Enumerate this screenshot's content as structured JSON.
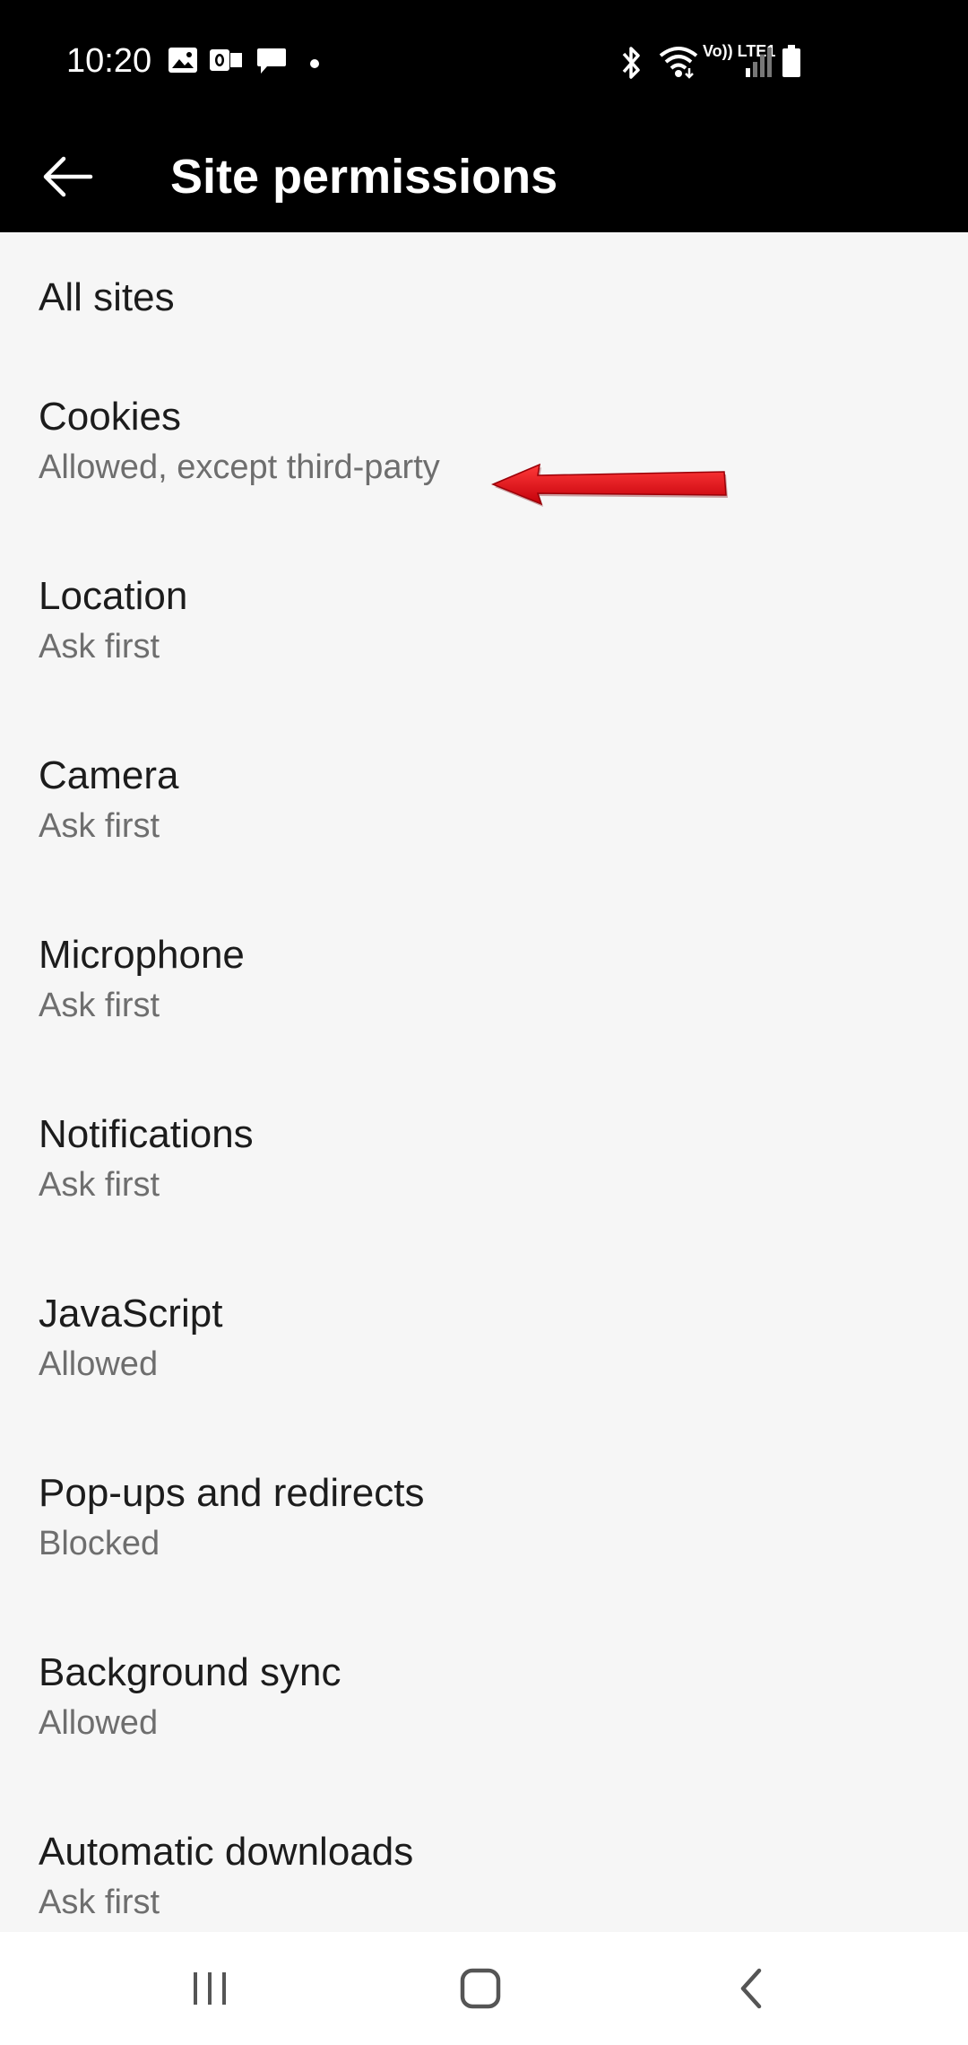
{
  "status_bar": {
    "time": "10:20",
    "icons_left": [
      "gallery-icon",
      "outlook-icon",
      "message-icon",
      "dot-icon"
    ],
    "icons_right": [
      "bluetooth-icon",
      "wifi-icon",
      "volte-icon",
      "signal-icon",
      "battery-icon"
    ],
    "volte_label": "Vo)) LTE1"
  },
  "app_bar": {
    "title": "Site permissions",
    "back_icon": "arrow-left-icon"
  },
  "permissions": [
    {
      "title": "All sites",
      "subtitle": ""
    },
    {
      "title": "Cookies",
      "subtitle": "Allowed, except third-party"
    },
    {
      "title": "Location",
      "subtitle": "Ask first"
    },
    {
      "title": "Camera",
      "subtitle": "Ask first"
    },
    {
      "title": "Microphone",
      "subtitle": "Ask first"
    },
    {
      "title": "Notifications",
      "subtitle": "Ask first"
    },
    {
      "title": "JavaScript",
      "subtitle": "Allowed"
    },
    {
      "title": "Pop-ups and redirects",
      "subtitle": "Blocked"
    },
    {
      "title": "Background sync",
      "subtitle": "Allowed"
    },
    {
      "title": "Automatic downloads",
      "subtitle": "Ask first"
    }
  ],
  "annotation": {
    "icon": "red-arrow-annotation",
    "color": "#e8101a"
  },
  "nav_bar": {
    "recents_icon": "recents-icon",
    "home_icon": "home-icon",
    "back_icon": "nav-back-icon"
  },
  "colors": {
    "header_bg": "#000000",
    "list_bg": "#f6f6f6",
    "title_text": "#1c1c1c",
    "subtitle_text": "#6e6e6e"
  }
}
